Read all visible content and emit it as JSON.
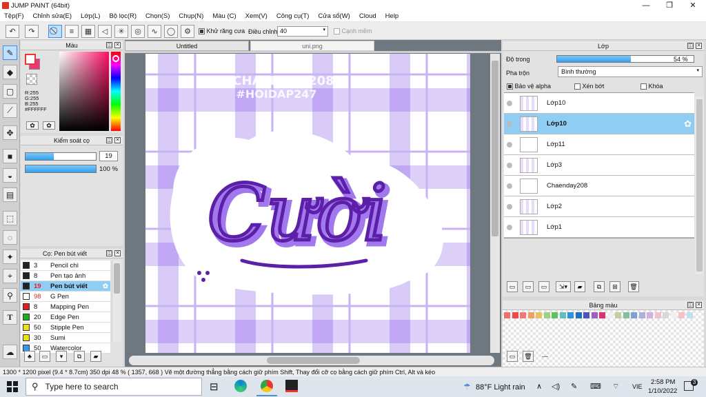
{
  "window": {
    "title": "JUMP PAINT (64bit)",
    "min": "—",
    "max": "❐",
    "close": "✕"
  },
  "menu": [
    "Tệp(F)",
    "Chỉnh sửa(E)",
    "Lớp(L)",
    "Bộ lọc(R)",
    "Chọn(S)",
    "Chụp(N)",
    "Màu (C)",
    "Xem(V)",
    "Công cụ(T)",
    "Cửa sổ(W)",
    "Cloud",
    "Help"
  ],
  "toolbar": {
    "antialias_label": "Khử răng cưa",
    "adjust_label": "Điều chỉnh",
    "adjust_value": "40",
    "edge_label": "Cạnh mềm"
  },
  "color_panel": {
    "title": "Màu",
    "r": "R:255",
    "g": "G:255",
    "b": "B:255",
    "hex": "#FFFFFF",
    "primary": "#ffffff",
    "secondary": "#e8397e"
  },
  "brush_control": {
    "title": "Kiểm soát cọ",
    "size": "19",
    "opacity": "100 %",
    "size_fraction": 0.4,
    "opacity_fraction": 1.0
  },
  "brush_panel": {
    "title": "Cọ: Pen bút viết",
    "items": [
      {
        "size": "3",
        "name": "Pencil chì",
        "color": "#222222",
        "sel": false,
        "red": false
      },
      {
        "size": "8",
        "name": "Pen tạo ảnh",
        "color": "#222222",
        "sel": false,
        "red": false
      },
      {
        "size": "19",
        "name": "Pen bút viết",
        "color": "#222222",
        "sel": true,
        "red": true
      },
      {
        "size": "98",
        "name": "G Pen",
        "color": "#ffffff",
        "sel": false,
        "red": true
      },
      {
        "size": "8",
        "name": "Mapping Pen",
        "color": "#e02020",
        "sel": false,
        "red": false
      },
      {
        "size": "20",
        "name": "Edge Pen",
        "color": "#22aa22",
        "sel": false,
        "red": false
      },
      {
        "size": "50",
        "name": "Stipple Pen",
        "color": "#e8e020",
        "sel": false,
        "red": false
      },
      {
        "size": "30",
        "name": "Sumi",
        "color": "#e8e020",
        "sel": false,
        "red": false
      },
      {
        "size": "50",
        "name": "Watercolor",
        "color": "#3399ee",
        "sel": false,
        "red": false
      }
    ]
  },
  "tabs": [
    "Untitled",
    "uni.png"
  ],
  "canvas": {
    "watermark1": "CHAENDAY208",
    "watermark2": "#HOIDAP247",
    "artwork_text": "Cười"
  },
  "layer_panel": {
    "title": "Lớp",
    "opacity_label": "Độ trong",
    "opacity_value": "54 %",
    "opacity_fraction": 0.54,
    "blend_label": "Pha trộn",
    "blend_value": "Bình thường",
    "protect_alpha": "Bảo vệ alpha",
    "clip": "Xén bớt",
    "lock": "Khóa",
    "layers": [
      {
        "name": "Lớp10",
        "sel": false
      },
      {
        "name": "Lớp10",
        "sel": true
      },
      {
        "name": "Lớp11",
        "sel": false
      },
      {
        "name": "Lớp3",
        "sel": false
      },
      {
        "name": "Chaenday208",
        "sel": false
      },
      {
        "name": "Lớp2",
        "sel": false
      },
      {
        "name": "Lớp1",
        "sel": false
      }
    ]
  },
  "palette": {
    "title": "Bảng màu",
    "colors": [
      "#f07070",
      "#f04848",
      "#f07878",
      "#f0a060",
      "#f0c060",
      "#a0d080",
      "#60c060",
      "#60c0c0",
      "#3090e0",
      "#2070c0",
      "#5050c0",
      "#a060c0",
      "#e03070",
      "#f0f0f0",
      "#c0d0a0",
      "#80c0a0",
      "#80a0d0",
      "#b0b0e0",
      "#d0b0e0",
      "#f0c0d0",
      "#d8d8d8",
      "#f0f0f0",
      "#f8c0c0",
      "#c0e0f0"
    ],
    "dash": "---"
  },
  "status": "1300 * 1200 pixel   (9.4 * 8.7cm)   350 dpi   48 %   ( 1357, 668 )   Vẽ một đường thẳng bằng cách giữ phím Shift, Thay đổi cỡ cọ bằng cách giữ phím Ctrl, Alt và kéo",
  "taskbar": {
    "search": "Type here to search",
    "weather": "88°F  Light rain",
    "lang": "VIE",
    "time": "2:58 PM",
    "date": "1/10/2022",
    "notif": "3"
  }
}
